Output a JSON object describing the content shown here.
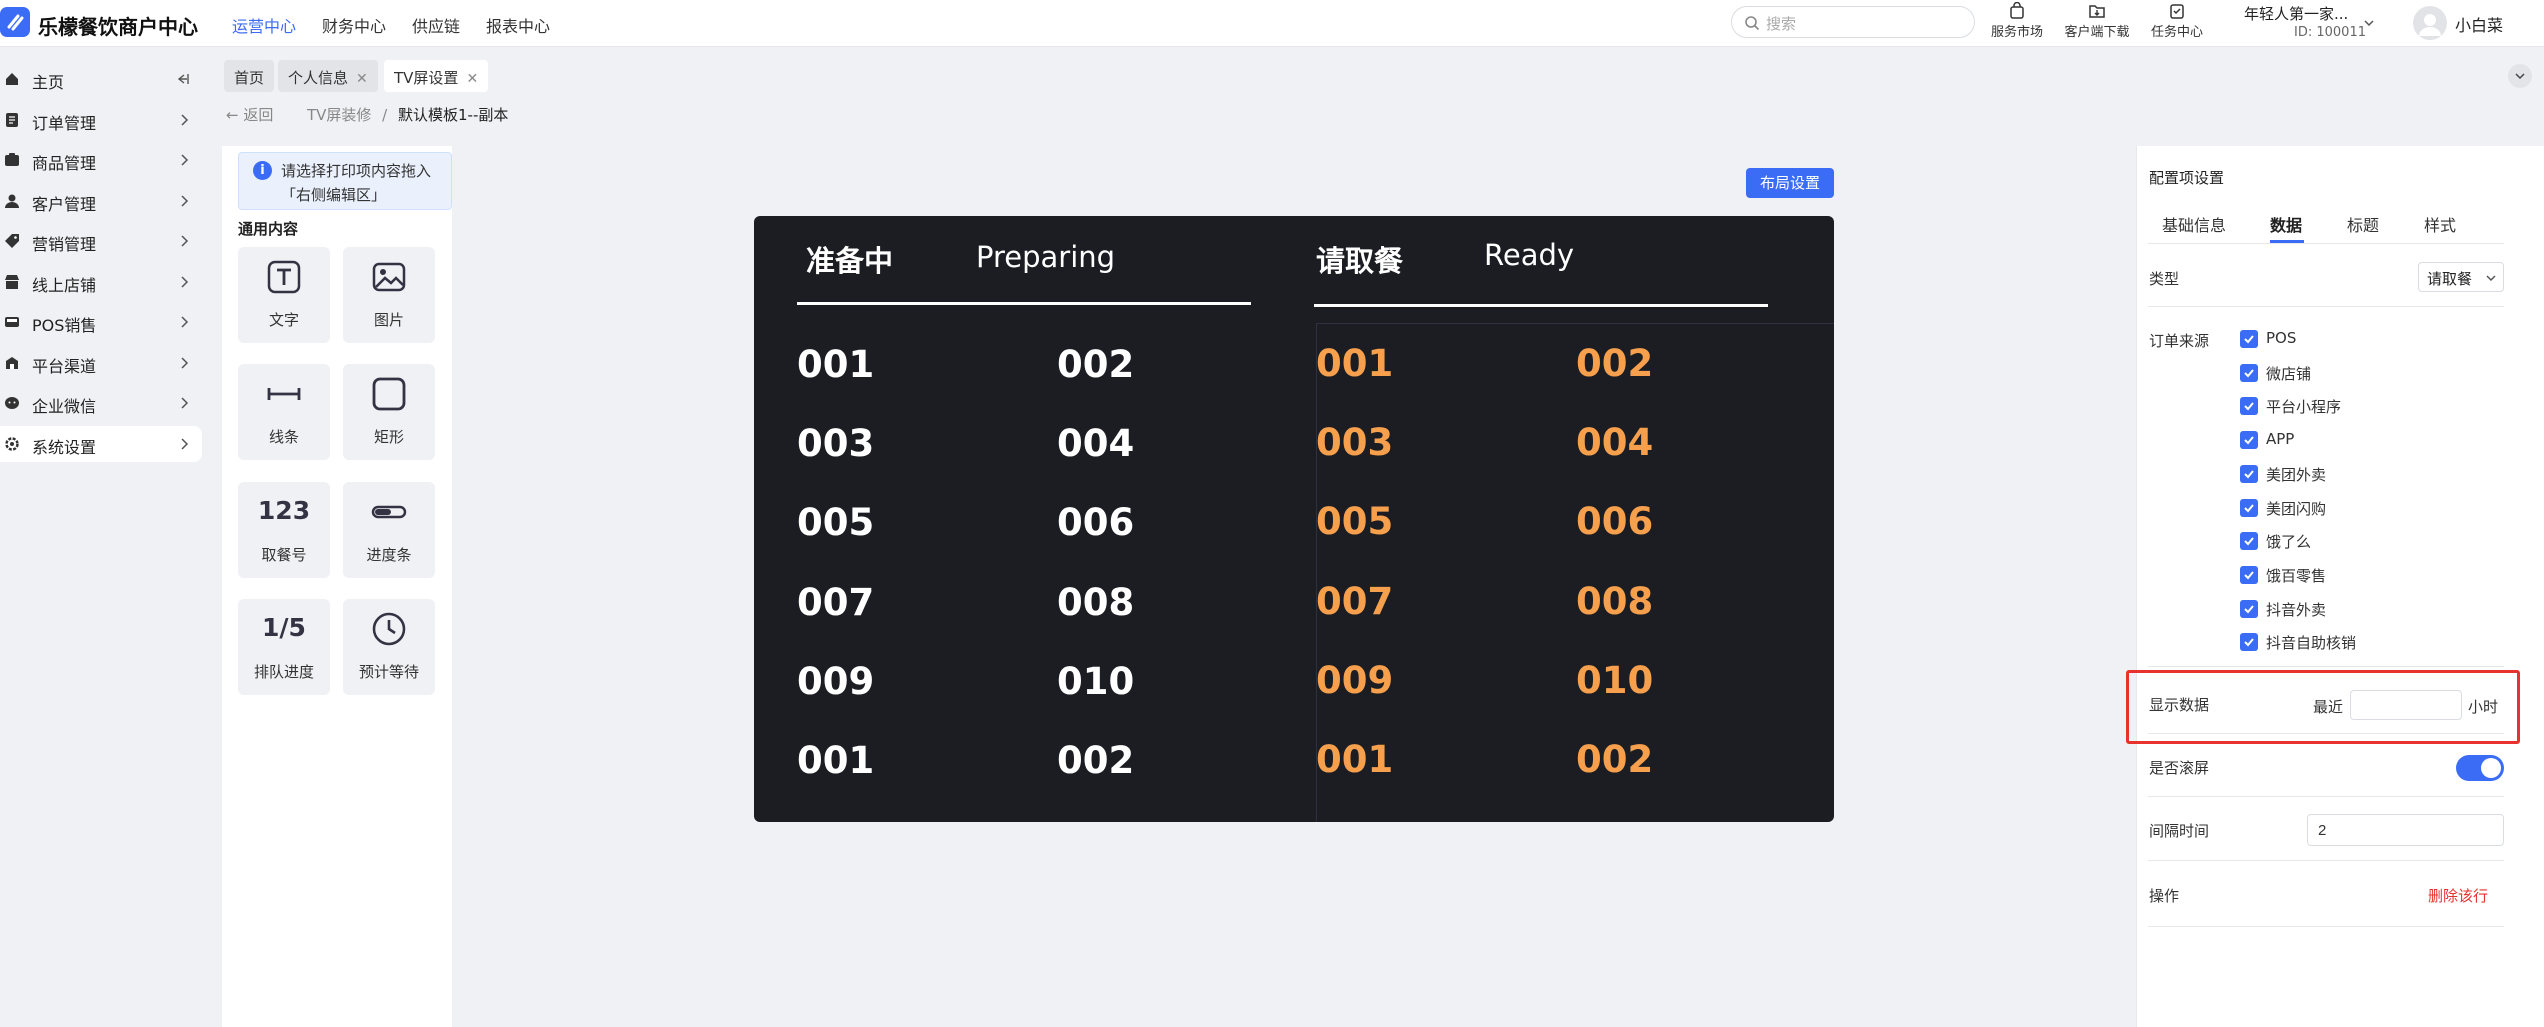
{
  "app": {
    "title": "乐檬餐饮商户中心"
  },
  "topnav": [
    "运营中心",
    "财务中心",
    "供应链",
    "报表中心"
  ],
  "search": {
    "placeholder": "搜索"
  },
  "toolbar": {
    "market": "服务市场",
    "download": "客户端下载",
    "tasks": "任务中心"
  },
  "account": {
    "name": "年轻人第一家...",
    "id": "ID: 100011",
    "user": "小白菜"
  },
  "sidebar": {
    "items": [
      {
        "label": "主页",
        "icon": "home-icon"
      },
      {
        "label": "订单管理",
        "icon": "order-icon"
      },
      {
        "label": "商品管理",
        "icon": "goods-icon"
      },
      {
        "label": "客户管理",
        "icon": "user-icon"
      },
      {
        "label": "营销管理",
        "icon": "tag-icon"
      },
      {
        "label": "线上店铺",
        "icon": "store-icon"
      },
      {
        "label": "POS销售",
        "icon": "pos-icon"
      },
      {
        "label": "平台渠道",
        "icon": "channel-icon"
      },
      {
        "label": "企业微信",
        "icon": "wechat-icon"
      },
      {
        "label": "系统设置",
        "icon": "settings-icon"
      }
    ]
  },
  "tabs": [
    {
      "label": "首页"
    },
    {
      "label": "个人信息"
    },
    {
      "label": "TV屏设置"
    }
  ],
  "breadcrumb": {
    "back": "返回",
    "parent": "TV屏装修",
    "separator": "/",
    "current": "默认模板1--副本"
  },
  "left_panel": {
    "hint": "请选择打印项内容拖入「右侧编辑区」",
    "section": "通用内容",
    "widgets": [
      {
        "label": "文字",
        "icon": "text-icon"
      },
      {
        "label": "图片",
        "icon": "image-icon"
      },
      {
        "label": "线条",
        "icon": "line-icon"
      },
      {
        "label": "矩形",
        "icon": "rectangle-icon"
      },
      {
        "label": "取餐号",
        "icon_text": "123"
      },
      {
        "label": "进度条",
        "icon": "progress-icon"
      },
      {
        "label": "排队进度",
        "icon_text": "1/5"
      },
      {
        "label": "预计等待",
        "icon": "clock-icon"
      }
    ]
  },
  "canvas": {
    "layout_button": "布局设置"
  },
  "tv": {
    "preparing": {
      "title": "准备中",
      "subtitle": "Preparing",
      "numbers": [
        "001",
        "002",
        "003",
        "004",
        "005",
        "006",
        "007",
        "008",
        "009",
        "010",
        "001",
        "002"
      ]
    },
    "ready": {
      "title": "请取餐",
      "subtitle": "Ready",
      "numbers": [
        "001",
        "002",
        "003",
        "004",
        "005",
        "006",
        "007",
        "008",
        "009",
        "010",
        "001",
        "002"
      ]
    },
    "ready_color": "#f6a04d"
  },
  "config": {
    "title": "配置项设置",
    "tabs": [
      "基础信息",
      "数据",
      "标题",
      "样式"
    ],
    "active_tab": "数据",
    "type_label": "类型",
    "type_value": "请取餐",
    "source_label": "订单来源",
    "sources": [
      "POS",
      "微店铺",
      "平台小程序",
      "APP",
      "美团外卖",
      "美团闪购",
      "饿了么",
      "饿百零售",
      "抖音外卖",
      "抖音自助核销"
    ],
    "display_label": "显示数据",
    "display_prefix": "最近",
    "display_value": "",
    "display_unit": "小时",
    "scroll_label": "是否滚屏",
    "scroll_on": true,
    "interval_label": "间隔时间",
    "interval_value": "2",
    "op_label": "操作",
    "delete_label": "删除该行"
  },
  "colors": {
    "accent": "#3b6cf6",
    "highlight": "#e8322e",
    "delete": "#e8322e"
  }
}
